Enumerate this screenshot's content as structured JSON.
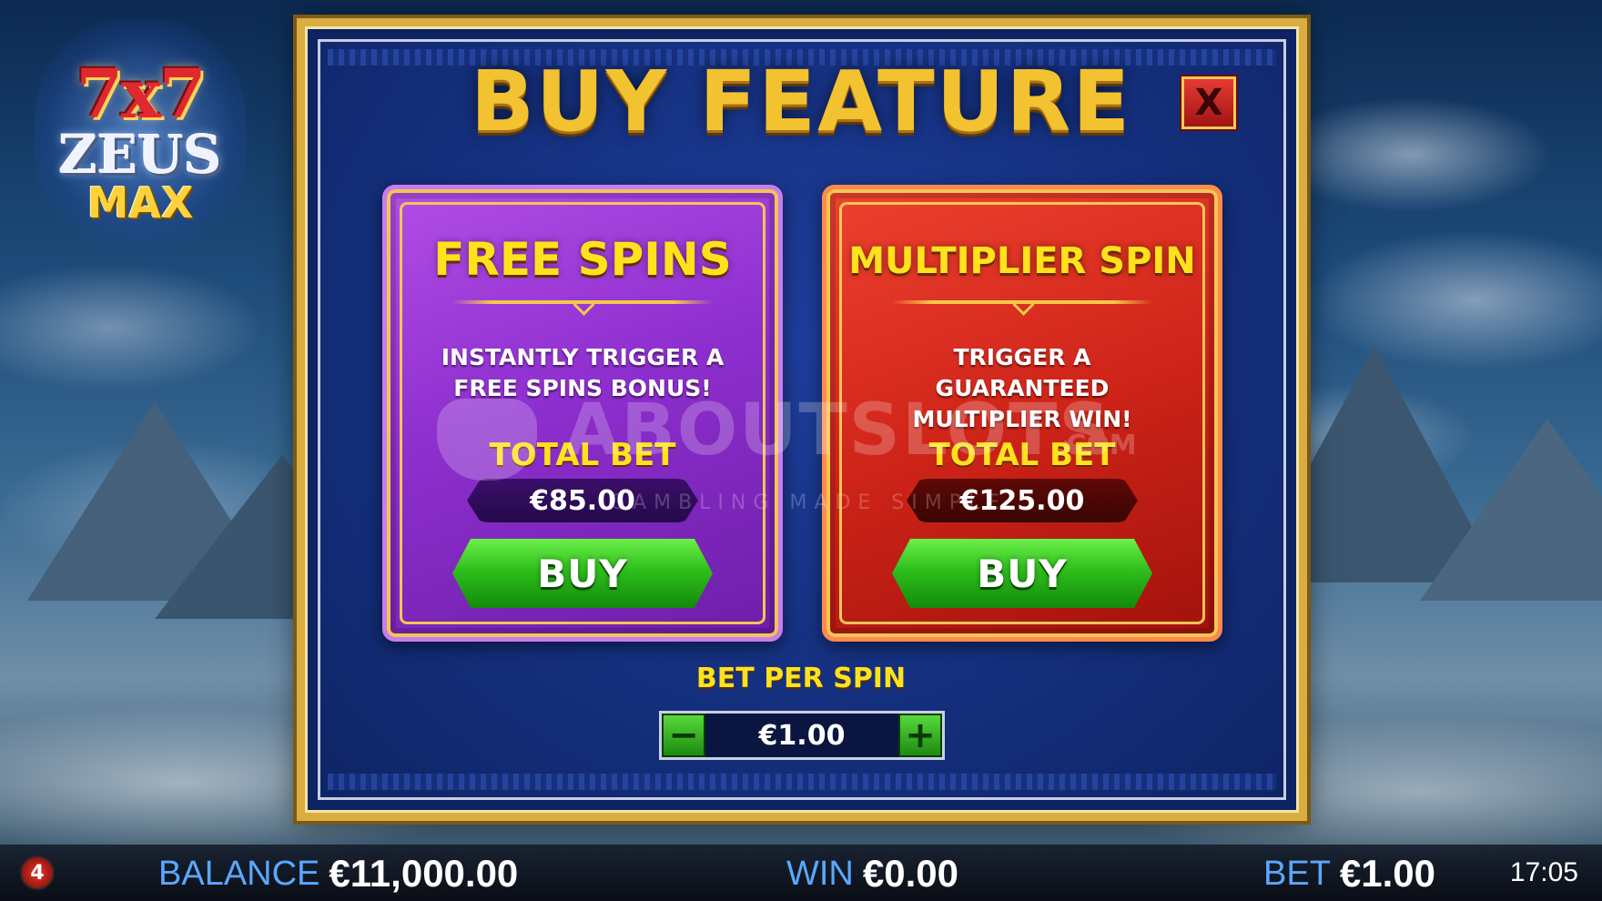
{
  "logo": {
    "line1": "7x7",
    "line2": "ZEUS",
    "line3": "MAX"
  },
  "modal": {
    "title": "BUY FEATURE",
    "close_label": "X",
    "cards": [
      {
        "title": "FREE SPINS",
        "description": "INSTANTLY TRIGGER A FREE SPINS BONUS!",
        "total_bet_label": "TOTAL BET",
        "total_bet_value": "€85.00",
        "buy_label": "BUY"
      },
      {
        "title": "MULTIPLIER SPIN",
        "description": "TRIGGER A GUARANTEED MULTIPLIER WIN!",
        "total_bet_label": "TOTAL BET",
        "total_bet_value": "€125.00",
        "buy_label": "BUY"
      }
    ],
    "bet_per_spin": {
      "label": "BET PER SPIN",
      "value": "€1.00",
      "minus_icon": "minus-icon",
      "plus_icon": "plus-icon"
    }
  },
  "watermark": {
    "main": "ABOUTSLOTS",
    "suffix": ".COM",
    "tagline": "GAMBLING MADE SIMPLE"
  },
  "bottom_bar": {
    "brand_badge": "4",
    "balance_label": "BALANCE",
    "balance_value": "€11,000.00",
    "win_label": "WIN",
    "win_value": "€0.00",
    "bet_label": "BET",
    "bet_value": "€1.00",
    "clock": "17:05"
  },
  "colors": {
    "title_gold": "#f2c230",
    "card_purple": "#8e2fcf",
    "card_red": "#cf2419",
    "buy_green": "#2fbf1c",
    "label_yellow": "#ffe21c",
    "bottom_label_blue": "#5aa8ff"
  }
}
